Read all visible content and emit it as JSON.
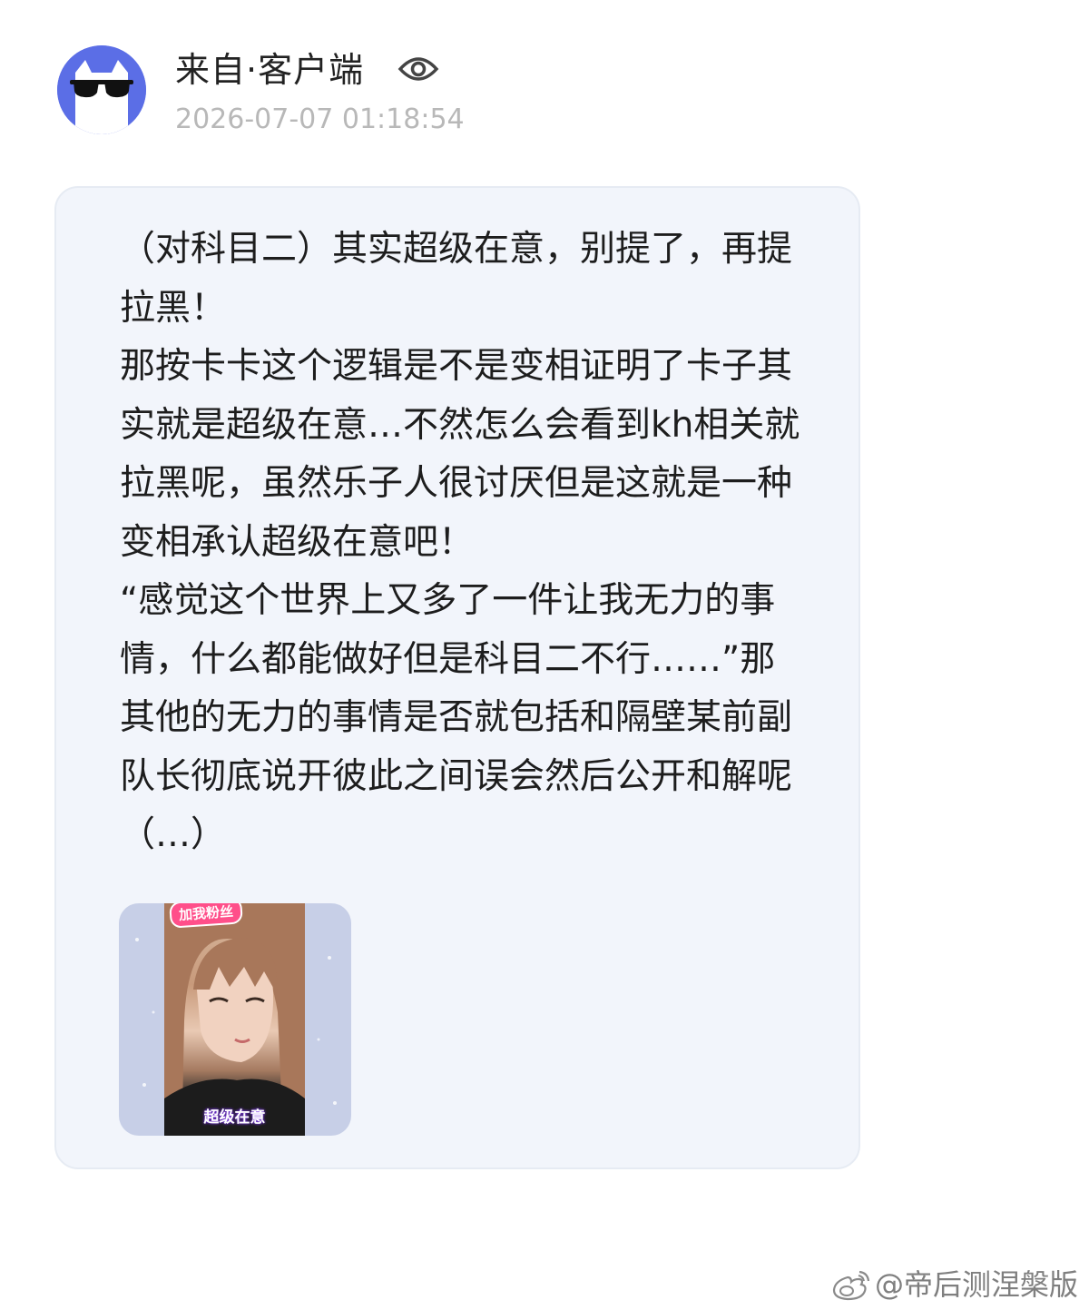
{
  "header": {
    "username": "来自·客户端",
    "timestamp": "2026-07-07 01:18:54",
    "avatar_icon": "sunglasses-cat-avatar",
    "visibility_icon": "eye-icon"
  },
  "post": {
    "text": "（对科目二）其实超级在意，别提了，再提拉黑！\n那按卡卡这个逻辑是不是变相证明了卡子其实就是超级在意…不然怎么会看到kh相关就拉黑呢，虽然乐子人很讨厌但是这就是一种变相承认超级在意吧！\n“感觉这个世界上又多了一件让我无力的事情，什么都能做好但是科目二不行……”那其他的无力的事情是否就包括和隔壁某前副队长彻底说开彼此之间误会然后公开和解呢（…）",
    "media": {
      "caption": "超级在意",
      "sticker_text": "加我粉丝"
    }
  },
  "watermark": {
    "text": "@帝后测涅槃版",
    "icon": "weibo-icon"
  },
  "colors": {
    "avatar_bg": "#5b6ee6",
    "card_bg": "#f2f5fb",
    "timestamp": "#b8b8b8"
  }
}
